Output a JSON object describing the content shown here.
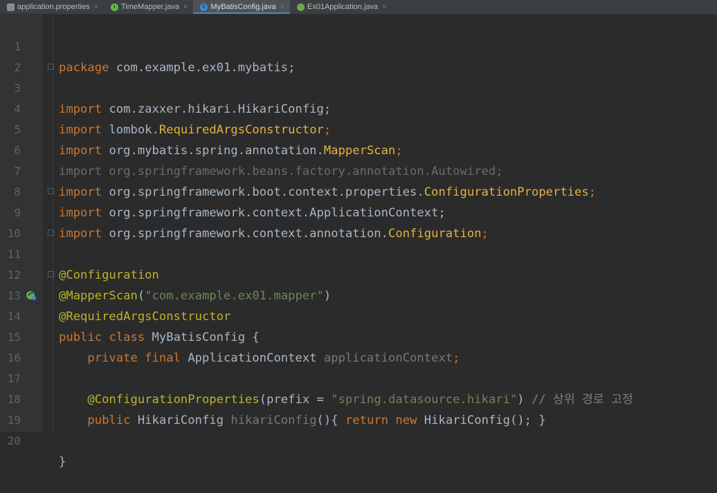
{
  "tabs": [
    {
      "label": "application.properties",
      "icon": "properties-file-icon",
      "active": false
    },
    {
      "label": "TimeMapper.java",
      "icon": "interface-icon",
      "active": false
    },
    {
      "label": "MyBatisConfig.java",
      "icon": "class-icon",
      "active": true
    },
    {
      "label": "Ex01Application.java",
      "icon": "spring-boot-icon",
      "active": false
    }
  ],
  "close_glyph": "×",
  "colors": {
    "background": "#2b2b2b",
    "keyword": "#cc7832",
    "annotation": "#bbb529",
    "string": "#6a8759",
    "comment": "#808080",
    "default_text": "#a9b7c6"
  },
  "code": {
    "line_numbers": [
      "1",
      "2",
      "3",
      "4",
      "5",
      "6",
      "7",
      "8",
      "9",
      "10",
      "11",
      "12",
      "13",
      "14",
      "15",
      "16",
      "17",
      "18",
      "19",
      "20"
    ],
    "l1": {
      "kw": "package",
      "rest": " com.example.ex01.mybatis;"
    },
    "l3": {
      "kw": "import",
      "rest": " com.zaxxer.hikari.HikariConfig;"
    },
    "l4": {
      "kw": "import",
      "pkg": " lombok.",
      "cls": "RequiredArgsConstructor",
      "end": ";"
    },
    "l5": {
      "kw": "import",
      "pkg": " org.mybatis.spring.annotation.",
      "cls": "MapperScan",
      "end": ";"
    },
    "l6": {
      "text": "import org.springframework.beans.factory.annotation.Autowired;"
    },
    "l7": {
      "kw": "import",
      "pkg": " org.springframework.boot.context.properties.",
      "cls": "ConfigurationProperties",
      "end": ";"
    },
    "l8": {
      "kw": "import",
      "rest": " org.springframework.context.ApplicationContext;"
    },
    "l9": {
      "kw": "import",
      "pkg": " org.springframework.context.annotation.",
      "cls": "Configuration",
      "end": ";"
    },
    "l11": {
      "ann": "@Configuration"
    },
    "l12": {
      "ann": "@MapperScan",
      "open": "(",
      "str": "\"com.example.ex01.mapper\"",
      "close": ")"
    },
    "l13": {
      "ann": "@RequiredArgsConstructor"
    },
    "l14": {
      "kw1": "public",
      "kw2": " class",
      "rest": " MyBatisConfig {"
    },
    "l15": {
      "kw1": "    private",
      "kw2": " final",
      "type": " ApplicationContext ",
      "field": "applicationContext",
      "end": ";"
    },
    "l17": {
      "ann": "    @ConfigurationProperties",
      "open": "(",
      "param": "prefix",
      "eq": " = ",
      "str": "\"spring.datasource.hikari\"",
      "close": ") ",
      "comment": "// 상위 경로 고정"
    },
    "l18": {
      "kw1": "    public",
      "type": " HikariConfig ",
      "method": "hikariConfig",
      "mid": "(){ ",
      "kw2": "return",
      "kw3": " new",
      "rest": " HikariConfig(); }"
    },
    "l20": {
      "text": "}"
    }
  }
}
